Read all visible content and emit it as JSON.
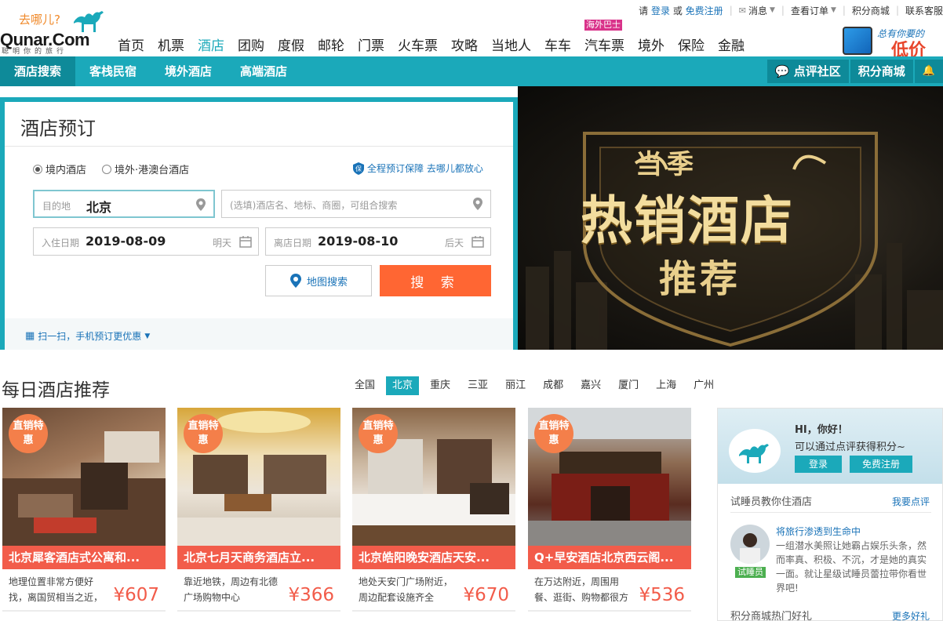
{
  "brand": {
    "slogan": "去哪儿?",
    "name": "Qunar.Com",
    "tagline": "聪明你的旅行"
  },
  "top_links": {
    "please": "请",
    "login": "登录",
    "or": "或",
    "register": "免费注册",
    "messages": "消息",
    "orders": "查看订单",
    "points_mall": "积分商城",
    "support": "联系客服"
  },
  "main_nav": [
    {
      "label": "首页"
    },
    {
      "label": "机票"
    },
    {
      "label": "酒店",
      "active": true
    },
    {
      "label": "团购"
    },
    {
      "label": "度假"
    },
    {
      "label": "邮轮"
    },
    {
      "label": "门票"
    },
    {
      "label": "火车票"
    },
    {
      "label": "攻略"
    },
    {
      "label": "当地人"
    },
    {
      "label": "车车"
    },
    {
      "label": "汽车票",
      "badge": "海外巴士"
    },
    {
      "label": "境外"
    },
    {
      "label": "保险"
    },
    {
      "label": "金融"
    }
  ],
  "app_promo": {
    "line1": "总有你要的",
    "line2": "低价"
  },
  "sub_nav": {
    "items": [
      "酒店搜索",
      "客栈民宿",
      "境外酒店",
      "高端酒店"
    ],
    "right": [
      "点评社区",
      "积分商城"
    ]
  },
  "booking": {
    "title": "酒店预订",
    "radio_domestic": "境内酒店",
    "radio_overseas": "境外·港澳台酒店",
    "guarantee": "全程预订保障 去哪儿都放心",
    "dest_label": "目的地",
    "dest_value": "北京",
    "keyword_placeholder": "(选填)酒店名、地标、商圈，可组合搜索",
    "checkin_label": "入住日期",
    "checkin_value": "2019-08-09",
    "checkin_hint": "明天",
    "checkout_label": "离店日期",
    "checkout_value": "2019-08-10",
    "checkout_hint": "后天",
    "map_search": "地图搜索",
    "search": "搜 索",
    "mobile_tip": "扫一扫，手机预订更优惠"
  },
  "banner": {
    "line1": "当季",
    "line2": "热销酒店",
    "line3": "推荐"
  },
  "recommend": {
    "title": "每日酒店推荐",
    "cities": [
      "全国",
      "北京",
      "重庆",
      "三亚",
      "丽江",
      "成都",
      "嘉兴",
      "厦门",
      "上海",
      "广州"
    ],
    "active_city": "北京",
    "tag": "直销特惠",
    "hotels": [
      {
        "name": "北京犀客酒店式公寓和...",
        "desc": "地理位置非常方便好找，离国贸相当之近，房内设施齐...",
        "price": "¥607"
      },
      {
        "name": "北京七月天商务酒店立...",
        "desc": "靠近地铁，周边有北德广场购物中心",
        "price": "¥366"
      },
      {
        "name": "北京皓阳晚安酒店天安...",
        "desc": "地处天安门广场附近，周边配套设施齐全",
        "price": "¥670"
      },
      {
        "name": "Q+早安酒店北京西云阁...",
        "desc": "在万达附近，周围用餐、逛街、购物都很方便",
        "price": "¥536"
      }
    ]
  },
  "sidebar": {
    "greeting": "HI，你好！",
    "hint": "可以通过点评获得积分~",
    "login": "登录",
    "register": "免费注册",
    "section1": "试睡员教你住酒店",
    "section1_more": "我要点评",
    "post_title": "将旅行渗透到生命中",
    "post_text": "一组潜水美照让她霸占娱乐头条，然而率真、积极、不沉，才是她的真实一面。就让星级试睡员蕾拉带你看世界吧!",
    "badge": "试睡员",
    "section2": "积分商城热门好礼",
    "section2_more": "更多好礼"
  },
  "colors": {
    "teal": "#1ba9ba",
    "orange": "#ff6633",
    "red": "#f25c4a",
    "link": "#1a73b8"
  }
}
